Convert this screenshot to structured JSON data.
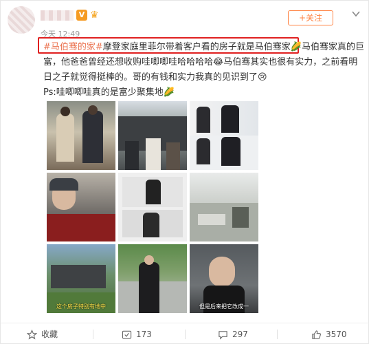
{
  "header": {
    "vip_badge": "V",
    "crown_icon": "crown-icon",
    "timestamp": "今天 12:49",
    "follow_label": "+关注",
    "more_icon": "chevron-down-icon"
  },
  "post": {
    "topic": "#马伯骞的家#",
    "line1": "摩登家庭里菲尔带着客户看的房子就是马伯骞家",
    "emoji1": "🌽",
    "line1b": "马伯骞家真的巨富，他爸爸曾经还想收购哇唧唧哇哈哈哈哈",
    "emoji2": "😂",
    "line1c": "马伯骞其实也很有实力，之前看明日之子就觉得挺棒的。哥的有钱和实力我真的见识到了",
    "emoji3": "😢",
    "ps": "Ps:哇唧唧哇真的是富少聚集地",
    "emoji4": "🌽"
  },
  "photos": [
    {
      "caption": ""
    },
    {
      "caption": ""
    },
    {
      "caption": ""
    },
    {
      "caption": ""
    },
    {
      "caption": ""
    },
    {
      "caption": ""
    },
    {
      "caption": "这个房子特别有地中"
    },
    {
      "caption": ""
    },
    {
      "caption": "但是后来把它改成一"
    }
  ],
  "footer": {
    "favorite_label": "收藏",
    "repost_count": "173",
    "comment_count": "297",
    "like_count": "3570"
  },
  "colors": {
    "accent": "#ff8140",
    "topic": "#eb7350",
    "highlight": "#e02020"
  }
}
